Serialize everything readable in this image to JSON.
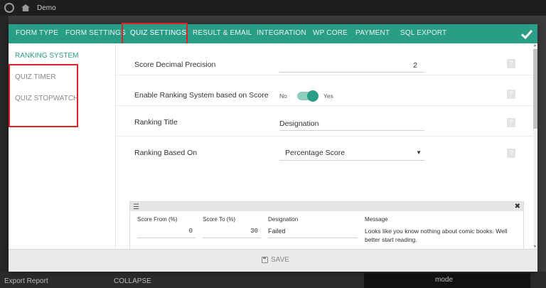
{
  "adminbar": {
    "site_name": "Demo"
  },
  "background": {
    "export_label": "Export Report",
    "collapse_label": "COLLAPSE",
    "mode_label": "mode"
  },
  "tabs": [
    {
      "label": "FORM TYPE"
    },
    {
      "label": "FORM SETTINGS"
    },
    {
      "label": "QUIZ SETTINGS"
    },
    {
      "label": "RESULT & EMAIL"
    },
    {
      "label": "INTEGRATION"
    },
    {
      "label": "WP CORE"
    },
    {
      "label": "PAYMENT"
    },
    {
      "label": "SQL EXPORT"
    }
  ],
  "sidenav": [
    {
      "label": "RANKING SYSTEM"
    },
    {
      "label": "QUIZ TIMER"
    },
    {
      "label": "QUIZ STOPWATCH"
    }
  ],
  "settings": {
    "decimal": {
      "label": "Score Decimal Precision",
      "value": "2"
    },
    "ranking_enable": {
      "label": "Enable Ranking System based on Score",
      "off_label": "No",
      "on_label": "Yes"
    },
    "ranking_title": {
      "label": "Ranking Title",
      "value": "Designation"
    },
    "ranking_based": {
      "label": "Ranking Based On",
      "value": "Percentage Score"
    },
    "help_glyph": "?"
  },
  "table": {
    "menu_glyph": "☰",
    "close_glyph": "✖",
    "headers": [
      "Score From (%)",
      "Score To (%)",
      "Designation",
      "Message"
    ],
    "row": {
      "from": "0",
      "to": "30",
      "designation": "Failed",
      "message": "Looks like you know nothing about comic books. Well better start reading."
    }
  },
  "footer": {
    "save_label": "SAVE"
  },
  "colors": {
    "accent": "#2a9d87",
    "highlight": "#e0212a"
  }
}
